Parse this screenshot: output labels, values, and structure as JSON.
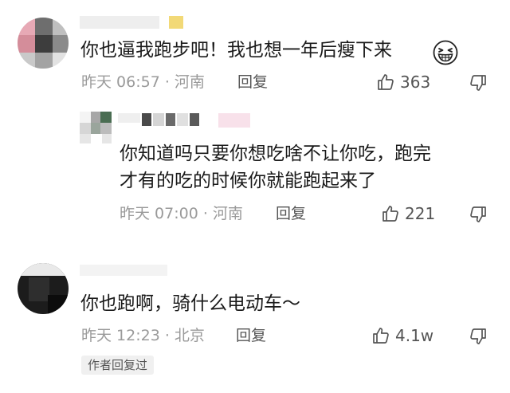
{
  "comments": [
    {
      "text": "你也逼我跑步吧！我也想一年后瘦下来",
      "emoji": "grinning-squint-face",
      "meta": "昨天 06:57 · 河南",
      "reply_label": "回复",
      "likes": "363"
    },
    {
      "text_line1": "你知道吗只要你想吃啥不让你吃，跑完",
      "text_line2": "才有的吃的时候你就能跑起来了",
      "meta": "昨天 07:00 · 河南",
      "reply_label": "回复",
      "likes": "221"
    },
    {
      "text": "你也跑啊，骑什么电动车～",
      "meta": "昨天 12:23 · 北京",
      "reply_label": "回复",
      "likes": "4.1w",
      "badge": "作者回复过"
    }
  ],
  "icons": [
    "thumbs-up-icon",
    "thumbs-down-icon"
  ],
  "colors": {
    "meta": "#9a9a9a",
    "text": "#1a1a1a",
    "icon": "#555555"
  }
}
